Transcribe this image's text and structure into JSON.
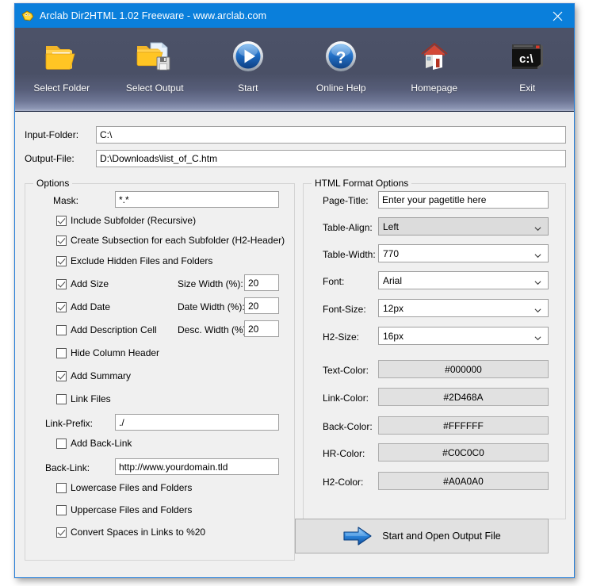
{
  "window": {
    "title": "Arclab Dir2HTML 1.02 Freeware - www.arclab.com",
    "close_label": "×",
    "app_icon": "arclab-bird-icon",
    "accent_titlebar": "#0a7fdb",
    "toolbar_top": "#4c5268",
    "toolbar_bottom": "#aab2c9"
  },
  "toolbar": {
    "items": [
      {
        "label": "Select Folder",
        "icon": "folder-open-icon"
      },
      {
        "label": "Select Output",
        "icon": "folder-save-icon"
      },
      {
        "label": "Start",
        "icon": "play-circle-icon"
      },
      {
        "label": "Online Help",
        "icon": "question-circle-icon"
      },
      {
        "label": "Homepage",
        "icon": "house-icon"
      },
      {
        "label": "Exit",
        "icon": "console-window-icon"
      }
    ]
  },
  "paths": {
    "input_folder_label": "Input-Folder:",
    "input_folder_value": "C:\\",
    "output_file_label": "Output-File:",
    "output_file_value": "D:\\Downloads\\list_of_C.htm"
  },
  "options": {
    "title": "Options",
    "mask_label": "Mask:",
    "mask_value": "*.*",
    "checkboxes": [
      {
        "label": "Include Subfolder (Recursive)",
        "checked": true
      },
      {
        "label": "Create Subsection for each Subfolder (H2-Header)",
        "checked": true
      },
      {
        "label": "Exclude Hidden Files and Folders",
        "checked": true
      },
      {
        "label": "Add Size",
        "checked": true
      },
      {
        "label": "Add Date",
        "checked": true
      },
      {
        "label": "Add Description Cell",
        "checked": false
      },
      {
        "label": "Hide Column Header",
        "checked": false
      },
      {
        "label": "Add Summary",
        "checked": true
      },
      {
        "label": "Link Files",
        "checked": false
      },
      {
        "label": "Add Back-Link",
        "checked": false
      },
      {
        "label": "Lowercase Files and Folders",
        "checked": false
      },
      {
        "label": "Uppercase Files and Folders",
        "checked": false
      },
      {
        "label": "Convert Spaces in Links to %20",
        "checked": true
      }
    ],
    "widths": [
      {
        "label": "Size Width (%):",
        "value": "20"
      },
      {
        "label": "Date Width (%):",
        "value": "20"
      },
      {
        "label": "Desc. Width (%):",
        "value": "20"
      }
    ],
    "link_prefix_label": "Link-Prefix:",
    "link_prefix_value": "./",
    "back_link_label": "Back-Link:",
    "back_link_value": "http://www.yourdomain.tld"
  },
  "html_format": {
    "title": "HTML Format Options",
    "page_title_label": "Page-Title:",
    "page_title_value": "Enter your pagetitle here",
    "selects": [
      {
        "label": "Table-Align:",
        "value": "Left",
        "focused": true
      },
      {
        "label": "Table-Width:",
        "value": "770",
        "focused": false
      },
      {
        "label": "Font:",
        "value": "Arial",
        "focused": false
      },
      {
        "label": "Font-Size:",
        "value": "12px",
        "focused": false
      },
      {
        "label": "H2-Size:",
        "value": "16px",
        "focused": false
      }
    ],
    "colors": [
      {
        "label": "Text-Color:",
        "value": "#000000"
      },
      {
        "label": "Link-Color:",
        "value": "#2D468A"
      },
      {
        "label": "Back-Color:",
        "value": "#FFFFFF"
      },
      {
        "label": "HR-Color:",
        "value": "#C0C0C0"
      },
      {
        "label": "H2-Color:",
        "value": "#A0A0A0"
      }
    ],
    "start_button_label": "Start and Open Output File",
    "start_button_icon": "blue-right-arrow-icon"
  }
}
